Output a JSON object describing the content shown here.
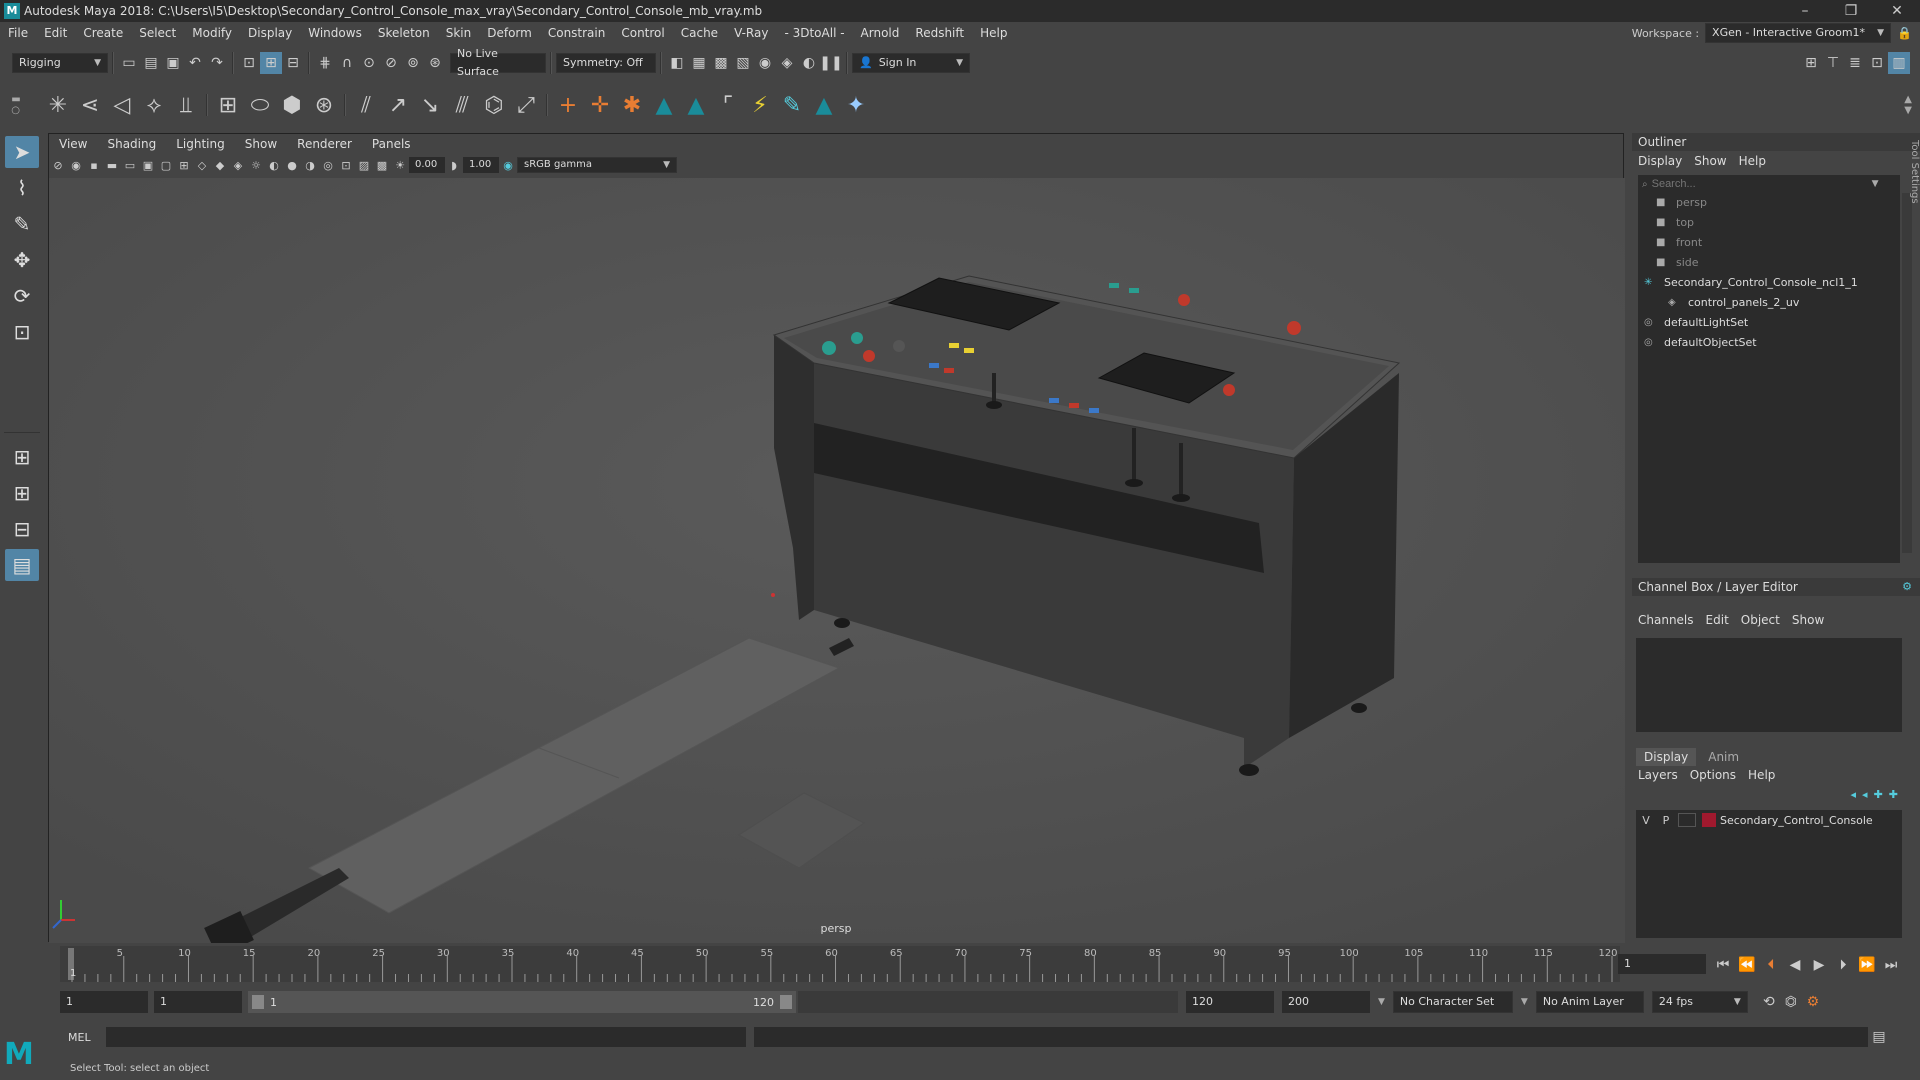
{
  "window": {
    "title": "Autodesk Maya 2018: C:\\Users\\I5\\Desktop\\Secondary_Control_Console_max_vray\\Secondary_Control_Console_mb_vray.mb",
    "minimize": "–",
    "maximize": "❐",
    "close": "✕"
  },
  "menu": [
    "File",
    "Edit",
    "Create",
    "Select",
    "Modify",
    "Display",
    "Windows",
    "Skeleton",
    "Skin",
    "Deform",
    "Constrain",
    "Control",
    "Cache",
    "V-Ray",
    "- 3DtoAll -",
    "Arnold",
    "Redshift",
    "Help"
  ],
  "workspace": {
    "label": "Workspace :",
    "value": "XGen - Interactive Groom1*"
  },
  "status": {
    "mode": "Rigging",
    "live_surface": "No Live Surface",
    "symmetry": "Symmetry: Off",
    "sign_in": "Sign In"
  },
  "viewport": {
    "menu": [
      "View",
      "Shading",
      "Lighting",
      "Show",
      "Renderer",
      "Panels"
    ],
    "exposure": "0.00",
    "gamma": "1.00",
    "colorspace": "sRGB gamma",
    "camera": "persp"
  },
  "outliner": {
    "title": "Outliner",
    "menu": [
      "Display",
      "Show",
      "Help"
    ],
    "search_placeholder": "Search...",
    "items": [
      {
        "label": "persp",
        "icon": "camera-icon",
        "indent": 1
      },
      {
        "label": "top",
        "icon": "camera-icon",
        "indent": 1
      },
      {
        "label": "front",
        "icon": "camera-icon",
        "indent": 1
      },
      {
        "label": "side",
        "icon": "camera-icon",
        "indent": 1
      },
      {
        "label": "Secondary_Control_Console_ncl1_1",
        "icon": "joint-icon",
        "indent": 0
      },
      {
        "label": "control_panels_2_uv",
        "icon": "mesh-icon",
        "indent": 2
      },
      {
        "label": "defaultLightSet",
        "icon": "set-icon",
        "indent": 0
      },
      {
        "label": "defaultObjectSet",
        "icon": "set-icon",
        "indent": 0
      }
    ]
  },
  "channelbox": {
    "title": "Channel Box / Layer Editor",
    "menu": [
      "Channels",
      "Edit",
      "Object",
      "Show"
    ],
    "tabs": [
      "Display",
      "Anim"
    ],
    "layer_menu": [
      "Layers",
      "Options",
      "Help"
    ],
    "layer": {
      "v": "V",
      "p": "P",
      "name": "Secondary_Control_Console",
      "color": "#a0192e"
    }
  },
  "timeline": {
    "ticks": [
      "5",
      "10",
      "15",
      "20",
      "25",
      "30",
      "35",
      "40",
      "45",
      "50",
      "55",
      "60",
      "65",
      "70",
      "75",
      "80",
      "85",
      "90",
      "95",
      "100",
      "105",
      "110",
      "115",
      "120"
    ],
    "current": "1",
    "current_field": "1"
  },
  "range": {
    "start": "1",
    "start2": "1",
    "slider_start": "1",
    "slider_end": "120",
    "end": "120",
    "end2": "200",
    "char_set": "No Character Set",
    "anim_layer": "No Anim Layer",
    "fps": "24 fps"
  },
  "cmd": {
    "lang": "MEL"
  },
  "help": {
    "text": "Select Tool: select an object"
  },
  "side_tab": "Tool Settings"
}
